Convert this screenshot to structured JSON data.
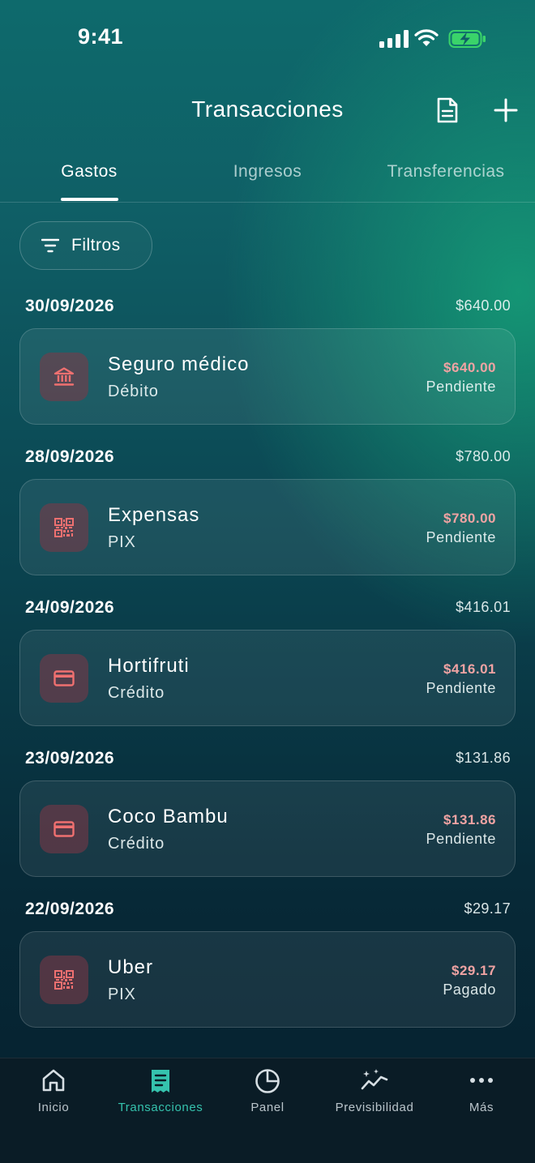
{
  "status_bar": {
    "time": "9:41"
  },
  "header": {
    "title": "Transacciones"
  },
  "tabs": [
    {
      "label": "Gastos",
      "active": true
    },
    {
      "label": "Ingresos",
      "active": false
    },
    {
      "label": "Transferencias",
      "active": false
    }
  ],
  "filter": {
    "label": "Filtros"
  },
  "groups": [
    {
      "date": "30/09/2026",
      "total": "$640.00",
      "items": [
        {
          "name": "Seguro médico",
          "method": "Débito",
          "amount": "$640.00",
          "status": "Pendiente",
          "icon": "bank-icon"
        }
      ]
    },
    {
      "date": "28/09/2026",
      "total": "$780.00",
      "items": [
        {
          "name": "Expensas",
          "method": "PIX",
          "amount": "$780.00",
          "status": "Pendiente",
          "icon": "qr-code-icon"
        }
      ]
    },
    {
      "date": "24/09/2026",
      "total": "$416.01",
      "items": [
        {
          "name": "Hortifruti",
          "method": "Crédito",
          "amount": "$416.01",
          "status": "Pendiente",
          "icon": "credit-card-icon"
        }
      ]
    },
    {
      "date": "23/09/2026",
      "total": "$131.86",
      "items": [
        {
          "name": "Coco Bambu",
          "method": "Crédito",
          "amount": "$131.86",
          "status": "Pendiente",
          "icon": "credit-card-icon"
        }
      ]
    },
    {
      "date": "22/09/2026",
      "total": "$29.17",
      "items": [
        {
          "name": "Uber",
          "method": "PIX",
          "amount": "$29.17",
          "status": "Pagado",
          "icon": "qr-code-icon"
        }
      ]
    }
  ],
  "nav": [
    {
      "label": "Inicio",
      "icon": "home-icon",
      "active": false
    },
    {
      "label": "Transacciones",
      "icon": "receipt-icon",
      "active": true
    },
    {
      "label": "Panel",
      "icon": "pie-chart-icon",
      "active": false
    },
    {
      "label": "Previsibilidad",
      "icon": "trend-sparkle-icon",
      "active": false
    },
    {
      "label": "Más",
      "icon": "more-dots-icon",
      "active": false
    }
  ],
  "colors": {
    "accent": "#35c2ad",
    "expense_amount": "#f0a3a3",
    "icon_tint": "#ef7070"
  }
}
